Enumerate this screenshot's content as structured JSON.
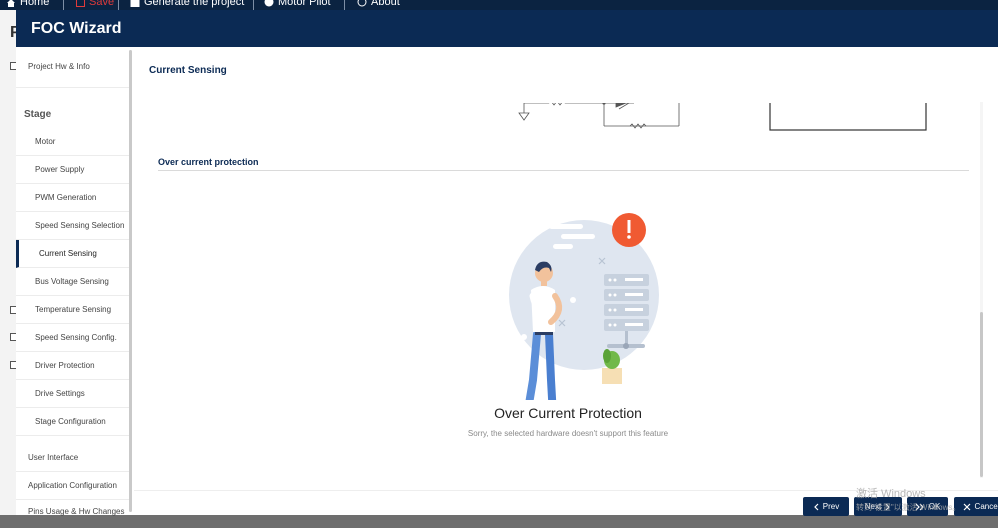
{
  "topbar": {
    "home_label": "Home",
    "save_label": "Save",
    "generate_label": "Generate the project",
    "motor_pilot_label": "Motor Pilot",
    "about_label": "About"
  },
  "background": {
    "letter": "P"
  },
  "wizard": {
    "title": "FOC Wizard"
  },
  "sidebar": {
    "project_hw": "Project Hw & Info",
    "stage_heading": "Stage",
    "items": [
      "Motor",
      "Power Supply",
      "PWM Generation",
      "Speed Sensing Selection",
      "Current Sensing",
      "Bus Voltage Sensing",
      "Temperature Sensing",
      "Speed Sensing Config.",
      "Driver Protection",
      "Drive Settings",
      "Stage Configuration"
    ],
    "user_interface": "User Interface",
    "app_config": "Application Configuration",
    "pins_usage": "Pins Usage & Hw Changes"
  },
  "main": {
    "section_title": "Current Sensing",
    "oc_heading": "Over current protection",
    "oc_title": "Over Current Protection",
    "oc_subtitle": "Sorry, the selected hardware doesn't support this feature"
  },
  "buttons": {
    "prev": "Prev",
    "next": "Next",
    "ok": "OK",
    "cancel": "Cancel"
  },
  "watermark": {
    "line1": "激活 Windows",
    "line2": "转到\"设置\"以激活 Windows。"
  },
  "colors": {
    "header_navy": "#0b2a54",
    "topbar": "#0b2341",
    "alert_orange": "#f05a32",
    "save_red": "#e03b3b"
  }
}
